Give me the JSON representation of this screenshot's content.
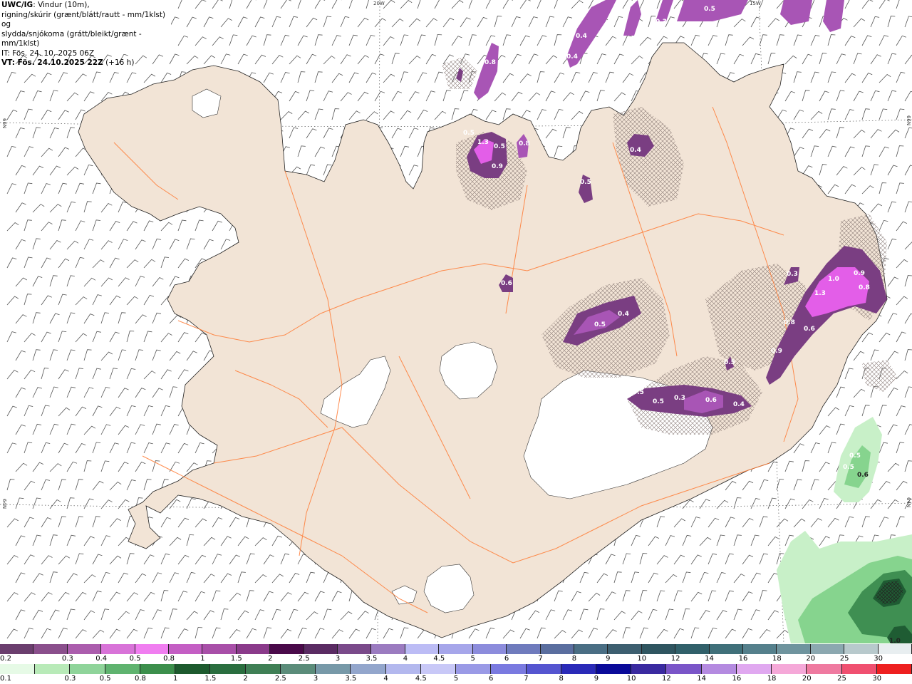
{
  "header": {
    "title": "UWC/IG",
    "line1_rest": ": Vindur (10m),",
    "line2": "rigning/skúrir (grænt/blátt/rautt - mm/1klst) og",
    "line3": "slydda/snjókoma (grátt/bleikt/grænt - mm/1klst)",
    "line4": "IT: Fös. 24. 10. 2025 06Z",
    "line5_bold": "VT: Fös. 24.10.2025 22Z",
    "line5_rest": " (+16 h)"
  },
  "grid_labels": {
    "lon_top_1": "20W",
    "lon_top_2": "15W",
    "lat_left_1": "66N",
    "lat_left_2": "64N",
    "lat_right_1": "66N",
    "lat_right_2": "64N"
  },
  "map": {
    "land_color": "#f2e4d6",
    "road_color": "#ff7a33",
    "snow_colors": [
      "#7a3e82",
      "#a855b5",
      "#e35ee8"
    ],
    "rain_colors": [
      "#c8f0c8",
      "#86d48e",
      "#3f8f52",
      "#1f5c33"
    ],
    "labels": {
      "p1": "0.3",
      "p2": "0.5",
      "p3": "0.4",
      "p4": "0.4",
      "p5": "0.5",
      "p6": "0.8",
      "p7": "0.5",
      "p8": "1.3",
      "p9": "0.5",
      "p10": "0.8",
      "p11": "0.9",
      "p12": "0.4",
      "p13": "0.5",
      "p14": "0.6",
      "p15": "0.5",
      "p16": "0.4",
      "p17": "0.3",
      "p18": "1.0",
      "p19": "0.9",
      "p20": "1.3",
      "p21": "0.8",
      "p22": "0.8",
      "p23": "0.6",
      "p24": "0.9",
      "p25": "0.5",
      "p26": "0.3",
      "p27": "0.5",
      "p28": "0.6",
      "p29": "0.4",
      "p30": "0.5",
      "p31": "0.5",
      "p32": "0.6",
      "p33": "1.0"
    }
  },
  "legend": {
    "snow": {
      "labels": [
        "0.2",
        "0.3",
        "0.4",
        "0.5",
        "0.8",
        "1",
        "1.5",
        "2",
        "2.5",
        "3",
        "3.5",
        "4",
        "4.5",
        "5",
        "6",
        "7",
        "8",
        "9",
        "10",
        "12",
        "14",
        "16",
        "18",
        "20",
        "25",
        "30"
      ],
      "colors": [
        "#6b3e6e",
        "#8a4f8c",
        "#ab5dad",
        "#d873d8",
        "#f07ef0",
        "#c45ec4",
        "#a84fa8",
        "#8a3a8a",
        "#4a0a4a",
        "#5a2b63",
        "#7a4a8a",
        "#9b7bc0",
        "#bcbcf5",
        "#a6a6ea",
        "#8c8cdc",
        "#6f7bbd",
        "#5a6e9f",
        "#4a6e84",
        "#3d5f70",
        "#2f5560",
        "#31606a",
        "#40707a",
        "#55808c",
        "#6f949e",
        "#8ca8b0",
        "#b8c9cc",
        "#e8eef0"
      ]
    },
    "rain": {
      "labels": [
        "0.1",
        "0.3",
        "0.5",
        "0.8",
        "1",
        "1.5",
        "2",
        "2.5",
        "3",
        "3.5",
        "4",
        "4.5",
        "5",
        "6",
        "7",
        "8",
        "9",
        "10",
        "12",
        "14",
        "16",
        "18",
        "20",
        "25",
        "30"
      ],
      "colors": [
        "#e6fae6",
        "#b8eab8",
        "#8fd49a",
        "#5fb36f",
        "#3c8f4c",
        "#1d5a2e",
        "#2a6e3f",
        "#3f7f55",
        "#5b8c7a",
        "#7799a8",
        "#93a6cc",
        "#b3b8ee",
        "#c8c8f7",
        "#9a9ae6",
        "#7a7ae0",
        "#5555d0",
        "#2a2ab8",
        "#0a0a99",
        "#3a2aa0",
        "#7a55c8",
        "#b48ae0",
        "#e0a8f0",
        "#f5a8d8",
        "#ef7aa0",
        "#f05070",
        "#ee2020"
      ]
    }
  }
}
